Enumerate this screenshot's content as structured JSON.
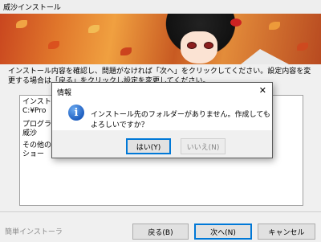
{
  "window": {
    "title": "威沙インストール"
  },
  "description": "インストール内容を確認し、問題がなければ「次へ」をクリックしてください。設定内容を変更する場合は「戻る」をクリックし設定を変更してください。",
  "summary_list": [
    "インストール先フォルダー：",
    "C:¥Pro",
    "",
    "プログラ",
    "威沙",
    "",
    "その他の",
    "ショー"
  ],
  "footer": {
    "easy_install_label": "簡単インストーラ",
    "back_button": "戻る(B)",
    "next_button": "次へ(N)",
    "cancel_button": "キャンセル"
  },
  "dialog": {
    "title": "情報",
    "message": "インストール先のフォルダーがありません。作成してもよろしいですか？",
    "yes_button": "はい(Y)",
    "no_button": "いいえ(N)",
    "icon": "info-icon",
    "close_glyph": "✕"
  },
  "colors": {
    "accent": "#0078d7",
    "banner": "#e0762b"
  }
}
